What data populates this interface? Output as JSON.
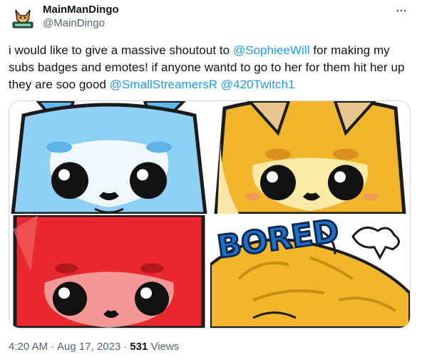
{
  "author": {
    "display_name": "MainManDingo",
    "handle": "@MainDingo"
  },
  "tweet": {
    "text_parts": [
      {
        "type": "text",
        "value": "i would like to give a massive shoutout to "
      },
      {
        "type": "mention",
        "value": "@SophieeWill"
      },
      {
        "type": "text",
        "value": " for making my subs badges and emotes! if anyone wantd to go to her for them hit her up they are soo good "
      },
      {
        "type": "mention",
        "value": "@SmallStreamersR"
      },
      {
        "type": "text",
        "value": " "
      },
      {
        "type": "mention",
        "value": "@420Twitch1"
      }
    ],
    "media": [
      {
        "name": "blue-fox-emote"
      },
      {
        "name": "yellow-fox-emote"
      },
      {
        "name": "red-fox-emote"
      },
      {
        "name": "bored-emote",
        "caption": "BORED"
      }
    ],
    "time": "4:20 AM",
    "separator": "·",
    "date": "Aug 17, 2023",
    "views_count": "531",
    "views_label": "Views"
  },
  "icons": {
    "more": "more-horizontal-icon"
  },
  "colors": {
    "link": "#1d9bf0",
    "text": "#0f1419",
    "secondary": "#536471",
    "border": "#cfd9de"
  }
}
